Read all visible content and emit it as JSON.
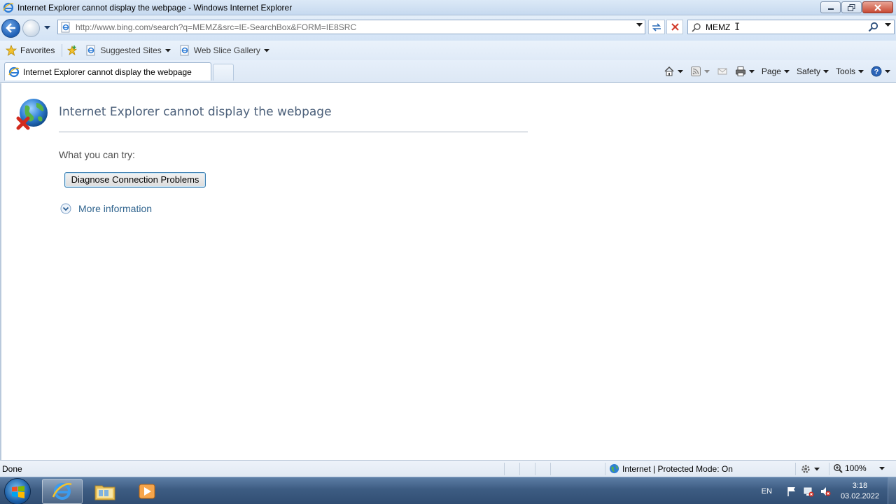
{
  "window": {
    "title": "Internet Explorer cannot display the webpage - Windows Internet Explorer",
    "controls": [
      "minimize-icon",
      "restore-icon",
      "close-icon"
    ]
  },
  "navbar": {
    "url": "http://www.bing.com/search?q=MEMZ&src=IE-SearchBox&FORM=IE8SRC",
    "search_value": "MEMZ"
  },
  "favorites_bar": {
    "favorites_label": "Favorites",
    "items": [
      {
        "label": "Suggested Sites"
      },
      {
        "label": "Web Slice Gallery"
      }
    ]
  },
  "tabs": [
    {
      "label": "Internet Explorer cannot display the webpage"
    }
  ],
  "command_bar": {
    "page_label": "Page",
    "safety_label": "Safety",
    "tools_label": "Tools"
  },
  "content": {
    "heading": "Internet Explorer cannot display the webpage",
    "try_label": "What you can try:",
    "diagnose_button": "Diagnose Connection Problems",
    "more_info": "More information"
  },
  "statusbar": {
    "status": "Done",
    "zone": "Internet | Protected Mode: On",
    "zoom": "100%"
  },
  "taskbar": {
    "language": "EN",
    "time": "3:18",
    "date": "03.02.2022"
  },
  "colors": {
    "accent": "#1e5fb5",
    "heading": "#4c607a",
    "link": "#30648e"
  }
}
